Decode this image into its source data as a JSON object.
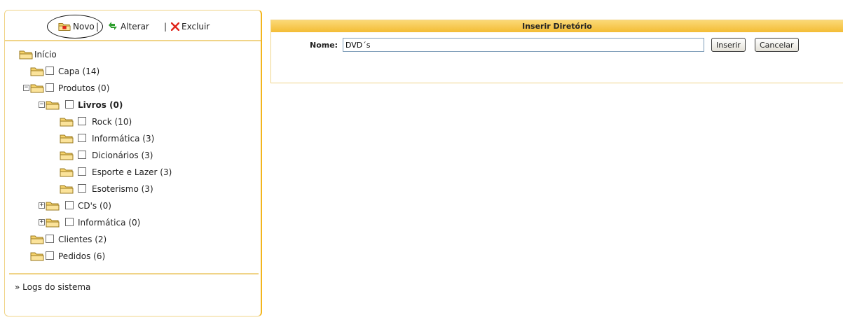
{
  "toolbar": {
    "new_label": "Novo",
    "edit_label": "Alterar",
    "delete_label": "Excluir",
    "separator": "|"
  },
  "tree": {
    "root_label": "Início",
    "items": [
      {
        "label": "Capa (14)"
      },
      {
        "label": "Produtos (0)",
        "expand": "−"
      },
      {
        "label": "Livros (0)",
        "expand": "−"
      },
      {
        "label": "Rock (10)"
      },
      {
        "label": "Informática (3)"
      },
      {
        "label": "Dicionários (3)"
      },
      {
        "label": "Esporte e Lazer (3)"
      },
      {
        "label": "Esoterismo (3)"
      },
      {
        "label": "CD's (0)",
        "expand": "+"
      },
      {
        "label": "Informática (0)",
        "expand": "+"
      },
      {
        "label": "Clientes (2)"
      },
      {
        "label": "Pedidos (6)"
      }
    ]
  },
  "footer": {
    "logs_label": "» Logs do sistema"
  },
  "form": {
    "title": "Inserir Diretório",
    "name_label": "Nome:",
    "name_value": "DVD´s",
    "insert_label": "Inserir",
    "cancel_label": "Cancelar"
  },
  "colors": {
    "accent": "#f3bc35",
    "border": "#f0d488",
    "delete_red": "#e0241a",
    "edit_green": "#2e9e2e"
  },
  "icons": [
    "new-folder-icon",
    "edit-arrows-icon",
    "delete-x-icon",
    "folder-icon",
    "expand-icon",
    "collapse-icon"
  ]
}
